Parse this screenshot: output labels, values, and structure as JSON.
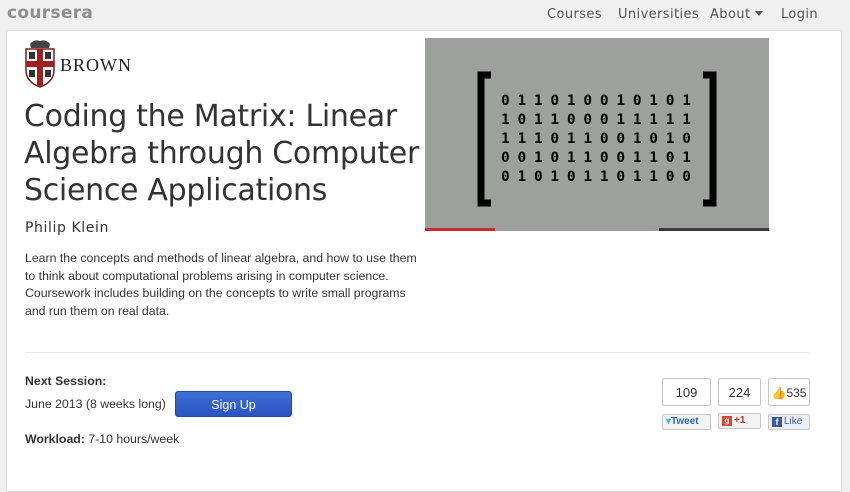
{
  "header": {
    "logo_text": "coursera",
    "nav": {
      "courses": "Courses",
      "universities": "Universities",
      "about": "About",
      "login": "Login"
    }
  },
  "course": {
    "university": "BROWN",
    "title": "Coding the Matrix: Linear Algebra through Computer Science Applications",
    "instructor": "Philip Klein",
    "description": "Learn the concepts and methods of linear algebra, and how to use them to think about computational problems arising in computer science. Coursework includes building on the concepts to write small programs and run them on real data.",
    "video_matrix": [
      "0110100101 01",
      "1011000111 11",
      "1110110010 10",
      "0010110011 01",
      "0101011011 00"
    ],
    "video_progress": 0.2
  },
  "session": {
    "label": "Next Session:",
    "date": "June 2013 (8 weeks long)",
    "signup": "Sign Up",
    "workload_label": "Workload:",
    "workload_value": "7-10 hours/week"
  },
  "social": {
    "tweet_count": "109",
    "tweet_label": "Tweet",
    "plus_count": "224",
    "plus_label": "+1",
    "like_count": "535",
    "like_label": "Like"
  },
  "colors": {
    "signup": "#2a54c1",
    "video_bg": "#9ea09e",
    "progress_played": "#c62d2d"
  }
}
